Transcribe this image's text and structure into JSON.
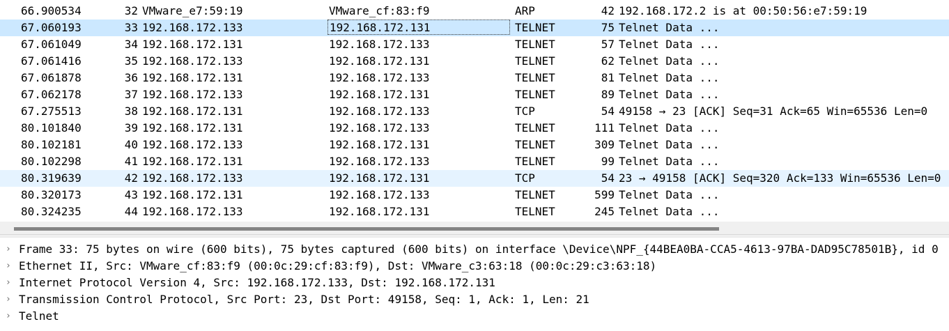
{
  "packets": [
    {
      "time": "66.900534",
      "no": "32",
      "src": "VMware_e7:59:19",
      "dst": "VMware_cf:83:f9",
      "proto": "ARP",
      "len": "42",
      "info": "192.168.172.2 is at 00:50:56:e7:59:19"
    },
    {
      "time": "67.060193",
      "no": "33",
      "src": "192.168.172.133",
      "dst": "192.168.172.131",
      "proto": "TELNET",
      "len": "75",
      "info": "Telnet Data ..."
    },
    {
      "time": "67.061049",
      "no": "34",
      "src": "192.168.172.131",
      "dst": "192.168.172.133",
      "proto": "TELNET",
      "len": "57",
      "info": "Telnet Data ..."
    },
    {
      "time": "67.061416",
      "no": "35",
      "src": "192.168.172.133",
      "dst": "192.168.172.131",
      "proto": "TELNET",
      "len": "62",
      "info": "Telnet Data ..."
    },
    {
      "time": "67.061878",
      "no": "36",
      "src": "192.168.172.131",
      "dst": "192.168.172.133",
      "proto": "TELNET",
      "len": "81",
      "info": "Telnet Data ..."
    },
    {
      "time": "67.062178",
      "no": "37",
      "src": "192.168.172.133",
      "dst": "192.168.172.131",
      "proto": "TELNET",
      "len": "89",
      "info": "Telnet Data ..."
    },
    {
      "time": "67.275513",
      "no": "38",
      "src": "192.168.172.131",
      "dst": "192.168.172.133",
      "proto": "TCP",
      "len": "54",
      "info": "49158 → 23 [ACK] Seq=31 Ack=65 Win=65536 Len=0"
    },
    {
      "time": "80.101840",
      "no": "39",
      "src": "192.168.172.131",
      "dst": "192.168.172.133",
      "proto": "TELNET",
      "len": "111",
      "info": "Telnet Data ..."
    },
    {
      "time": "80.102181",
      "no": "40",
      "src": "192.168.172.133",
      "dst": "192.168.172.131",
      "proto": "TELNET",
      "len": "309",
      "info": "Telnet Data ..."
    },
    {
      "time": "80.102298",
      "no": "41",
      "src": "192.168.172.131",
      "dst": "192.168.172.133",
      "proto": "TELNET",
      "len": "99",
      "info": "Telnet Data ..."
    },
    {
      "time": "80.319639",
      "no": "42",
      "src": "192.168.172.133",
      "dst": "192.168.172.131",
      "proto": "TCP",
      "len": "54",
      "info": "23 → 49158 [ACK] Seq=320 Ack=133 Win=65536 Len=0"
    },
    {
      "time": "80.320173",
      "no": "43",
      "src": "192.168.172.131",
      "dst": "192.168.172.133",
      "proto": "TELNET",
      "len": "599",
      "info": "Telnet Data ..."
    },
    {
      "time": "80.324235",
      "no": "44",
      "src": "192.168.172.133",
      "dst": "192.168.172.131",
      "proto": "TELNET",
      "len": "245",
      "info": "Telnet Data ..."
    }
  ],
  "details": [
    {
      "arrow": "expand-right-icon",
      "text": "Frame 33: 75 bytes on wire (600 bits), 75 bytes captured (600 bits) on interface \\Device\\NPF_{44BEA0BA-CCA5-4613-97BA-DAD95C78501B}, id 0"
    },
    {
      "arrow": "expand-right-icon",
      "text": "Ethernet II, Src: VMware_cf:83:f9 (00:0c:29:cf:83:f9), Dst: VMware_c3:63:18 (00:0c:29:c3:63:18)"
    },
    {
      "arrow": "expand-right-icon",
      "text": "Internet Protocol Version 4, Src: 192.168.172.133, Dst: 192.168.172.131"
    },
    {
      "arrow": "expand-right-icon",
      "text": "Transmission Control Protocol, Src Port: 23, Dst Port: 49158, Seq: 1, Ack: 1, Len: 21"
    },
    {
      "arrow": "expand-right-icon",
      "text": "Telnet"
    }
  ],
  "colors": {
    "selected_row": "#cce8ff",
    "highlight_row": "#e5f3ff",
    "scrollbar_thumb": "#858585",
    "pane_background": "#f0f0f0"
  }
}
